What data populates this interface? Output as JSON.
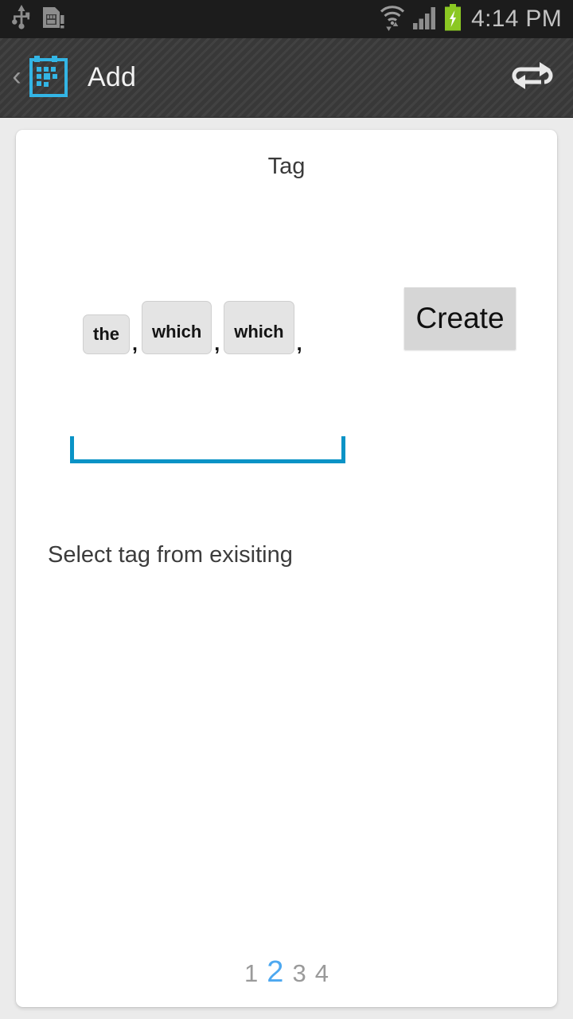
{
  "status_bar": {
    "icons": [
      "usb-icon",
      "sim-card-alert-icon",
      "wifi-data-icon",
      "cellular-signal-icon",
      "battery-charging-icon"
    ],
    "clock": "4:14 PM",
    "text_color": "#c3c3c3",
    "background": "#1c1c1c",
    "battery_color": "#8bc823"
  },
  "action_bar": {
    "back_label": "‹",
    "app_icon": "calendar-icon",
    "app_icon_color": "#33b5e5",
    "title": "Add",
    "repeat_icon": "repeat-icon"
  },
  "card": {
    "title": "Tag",
    "tags": [
      {
        "label": "the",
        "separator": ",",
        "size": "small"
      },
      {
        "label": "which",
        "separator": ",",
        "size": "large"
      },
      {
        "label": "which",
        "separator": ",",
        "size": "large"
      }
    ],
    "create_label": "Create",
    "tag_input": {
      "value": "",
      "placeholder": "",
      "accent_color": "#0a93c6"
    },
    "select_existing_label": "Select tag from exisiting",
    "pagination": {
      "pages": [
        "1",
        "2",
        "3",
        "4"
      ],
      "active": "2",
      "active_color": "#4da8f0",
      "inactive_color": "#9a9a9a"
    }
  }
}
